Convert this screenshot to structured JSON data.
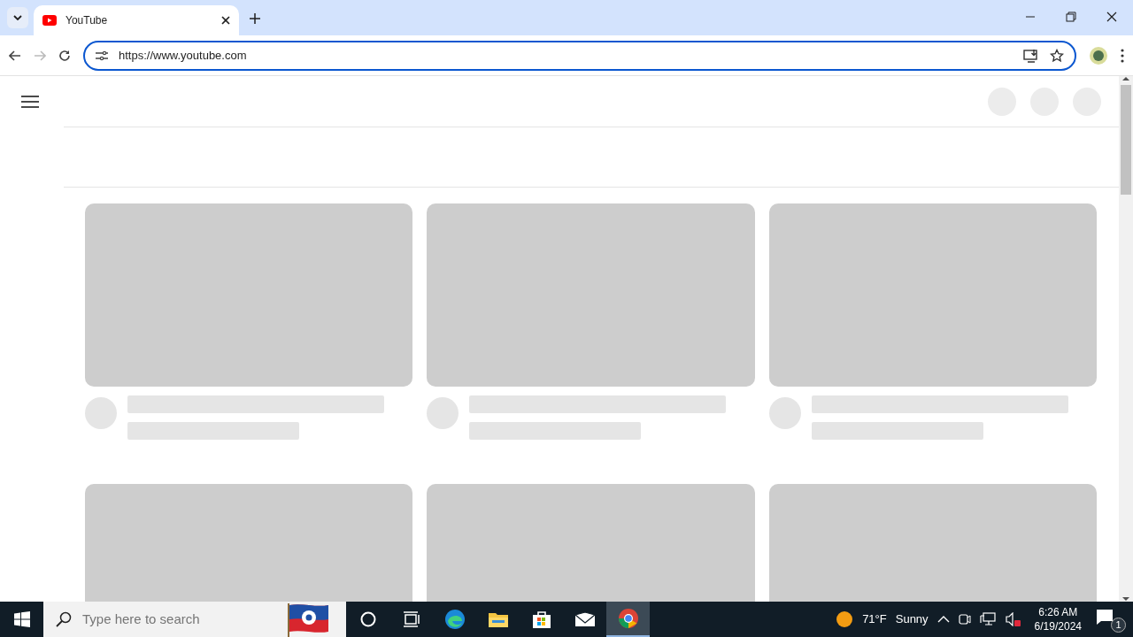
{
  "browser": {
    "tabs": [
      {
        "title": "YouTube",
        "selected": true
      }
    ],
    "address": {
      "value": "https://www.youtube.com"
    }
  },
  "page": {
    "header_buttons": [
      {
        "kind": "placeholder"
      },
      {
        "kind": "placeholder"
      },
      {
        "kind": "placeholder"
      }
    ],
    "video_cards": [
      {
        "kind": "skeleton"
      },
      {
        "kind": "skeleton"
      },
      {
        "kind": "skeleton"
      },
      {
        "kind": "thumbnail-only"
      },
      {
        "kind": "thumbnail-only"
      },
      {
        "kind": "thumbnail-only"
      }
    ]
  },
  "taskbar": {
    "search": {
      "placeholder": "Type here to search"
    },
    "apps": [
      {
        "kind": "cortana",
        "selected": false
      },
      {
        "kind": "task-view",
        "selected": false
      },
      {
        "kind": "edge",
        "selected": false
      },
      {
        "kind": "explorer",
        "selected": false
      },
      {
        "kind": "store",
        "selected": false
      },
      {
        "kind": "mail",
        "selected": false
      },
      {
        "kind": "chrome",
        "selected": true
      }
    ],
    "weather": {
      "temperature": "71°F",
      "condition": "Sunny"
    },
    "clock": {
      "time": "6:26 AM",
      "date": "6/19/2024"
    },
    "notifications": {
      "count": "1"
    }
  }
}
